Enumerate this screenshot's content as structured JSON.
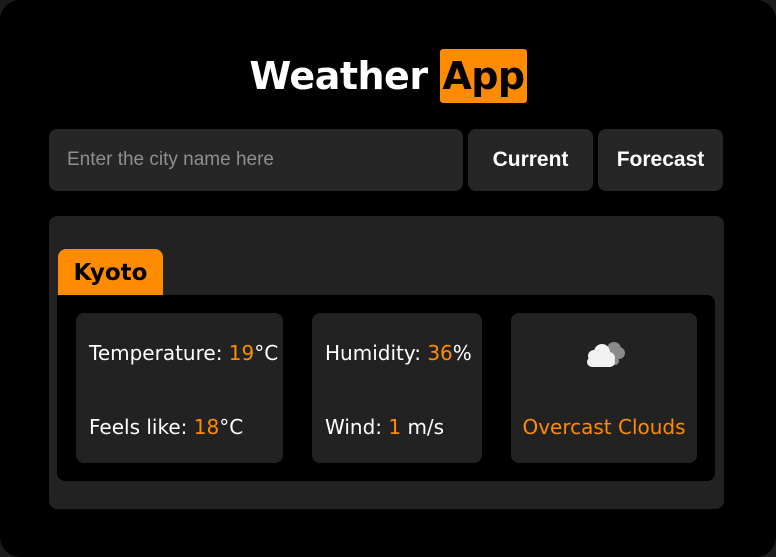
{
  "header": {
    "title_main": "Weather",
    "title_accent": "App"
  },
  "search": {
    "placeholder": "Enter the city name here",
    "value": ""
  },
  "buttons": {
    "current_label": "Current",
    "forecast_label": "Forecast"
  },
  "result": {
    "city": "Kyoto",
    "temperature": {
      "label": "Temperature: ",
      "value": "19",
      "unit": "°C"
    },
    "feels_like": {
      "label": "Feels like: ",
      "value": "18",
      "unit": "°C"
    },
    "humidity": {
      "label": "Humidity: ",
      "value": "36",
      "unit": "%"
    },
    "wind": {
      "label": "Wind: ",
      "value": "1",
      "unit": " m/s"
    },
    "condition": {
      "icon": "overcast-clouds-icon",
      "description": "Overcast Clouds"
    }
  },
  "colors": {
    "accent": "#ff8c00",
    "background": "#000000",
    "panel": "#222222",
    "input": "#262626",
    "text": "#ffffff"
  }
}
